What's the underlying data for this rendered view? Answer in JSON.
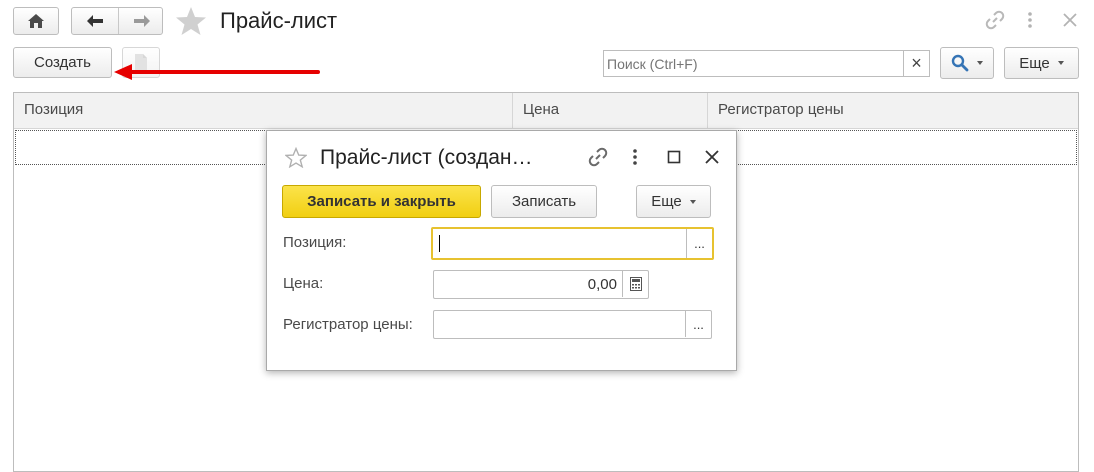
{
  "window": {
    "title": "Прайс-лист",
    "more_label": "Еще"
  },
  "toolbar": {
    "create_label": "Создать",
    "search_placeholder": "Поиск (Ctrl+F)",
    "search_clear": "×"
  },
  "table": {
    "columns": [
      "Позиция",
      "Цена",
      "Регистратор цены"
    ]
  },
  "dialog": {
    "title": "Прайс-лист (создан…",
    "save_close_label": "Записать и закрыть",
    "save_label": "Записать",
    "more_label": "Еще",
    "fields": {
      "position_label": "Позиция:",
      "price_label": "Цена:",
      "price_value": "0,00",
      "registrar_label": "Регистратор цены:",
      "select_glyph": "..."
    }
  },
  "colors": {
    "accent_yellow": "#f5d40f",
    "focus_border": "#e7c230",
    "arrow_red": "#e60000",
    "search_blue": "#3574b5"
  }
}
